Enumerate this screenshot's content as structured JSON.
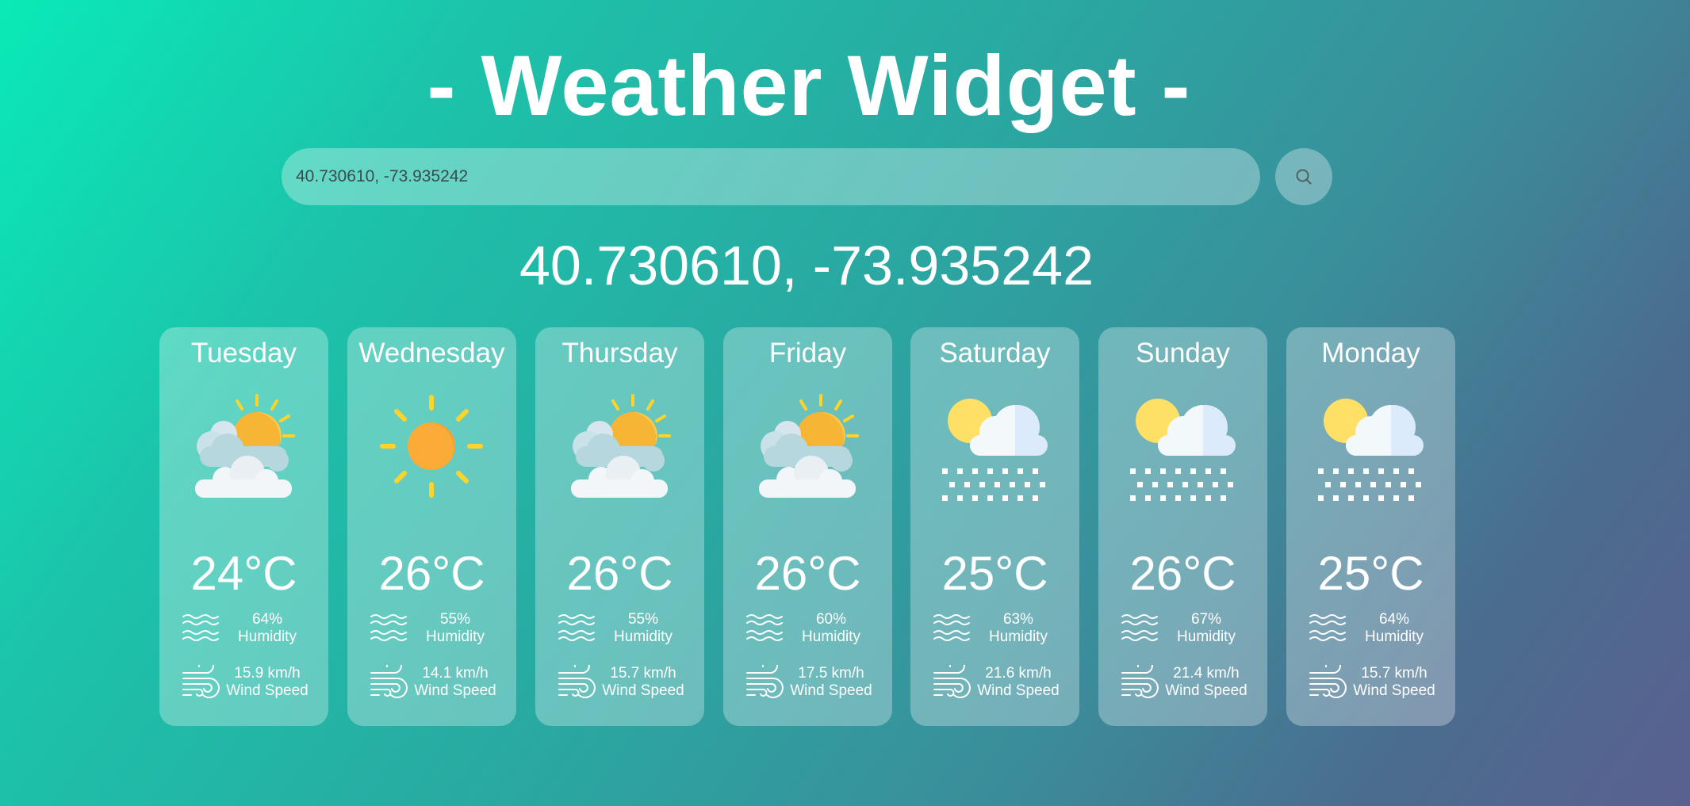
{
  "app": {
    "title": "- Weather Widget -"
  },
  "search": {
    "value": "40.730610, -73.935242",
    "button_icon": "search-icon"
  },
  "location": {
    "label": "40.730610, -73.935242"
  },
  "forecast": [
    {
      "day": "Tuesday",
      "icon": "partly-cloudy-icon",
      "temp": "24°C",
      "humidity": "64%",
      "humidity_label": "Humidity",
      "wind": "15.9 km/h",
      "wind_label": "Wind Speed"
    },
    {
      "day": "Wednesday",
      "icon": "sun-icon",
      "temp": "26°C",
      "humidity": "55%",
      "humidity_label": "Humidity",
      "wind": "14.1 km/h",
      "wind_label": "Wind Speed"
    },
    {
      "day": "Thursday",
      "icon": "partly-cloudy-icon",
      "temp": "26°C",
      "humidity": "55%",
      "humidity_label": "Humidity",
      "wind": "15.7 km/h",
      "wind_label": "Wind Speed"
    },
    {
      "day": "Friday",
      "icon": "partly-cloudy-icon",
      "temp": "26°C",
      "humidity": "60%",
      "humidity_label": "Humidity",
      "wind": "17.5 km/h",
      "wind_label": "Wind Speed"
    },
    {
      "day": "Saturday",
      "icon": "snow-icon",
      "temp": "25°C",
      "humidity": "63%",
      "humidity_label": "Humidity",
      "wind": "21.6 km/h",
      "wind_label": "Wind Speed"
    },
    {
      "day": "Sunday",
      "icon": "snow-icon",
      "temp": "26°C",
      "humidity": "67%",
      "humidity_label": "Humidity",
      "wind": "21.4 km/h",
      "wind_label": "Wind Speed"
    },
    {
      "day": "Monday",
      "icon": "snow-icon",
      "temp": "25°C",
      "humidity": "64%",
      "humidity_label": "Humidity",
      "wind": "15.7 km/h",
      "wind_label": "Wind Speed"
    }
  ],
  "colors": {
    "sun_yellow": "#ffd42a",
    "sun_orange": "#fbab37",
    "cloud_white": "#f3f6f8",
    "cloud_blue": "#dbe9f7",
    "cloud_back": "#bcd7e0"
  }
}
